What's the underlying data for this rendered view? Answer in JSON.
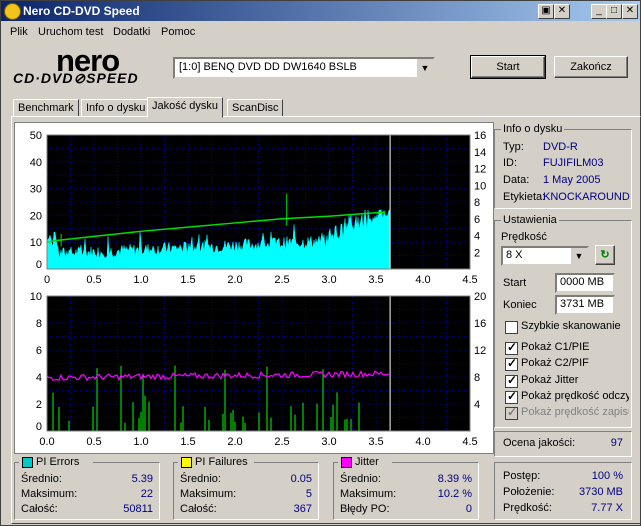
{
  "window": {
    "title": "Nero CD-DVD Speed"
  },
  "menu": [
    "Plik",
    "Uruchom test",
    "Dodatki",
    "Pomoc"
  ],
  "logo": {
    "brand": "nero",
    "product": "CD·DVD⊘SPEED"
  },
  "drive": {
    "selected": "[1:0]  BENQ DVD DD DW1640 BSLB"
  },
  "buttons": {
    "start": "Start",
    "stop": "Zakończ"
  },
  "tabs": [
    "Benchmark",
    "Info o dysku",
    "Jakość dysku",
    "ScanDisc"
  ],
  "active_tab": 2,
  "disc_info": {
    "title": "Info o dysku",
    "rows": [
      {
        "label": "Typ:",
        "value": "DVD-R"
      },
      {
        "label": "ID:",
        "value": "FUJIFILM03"
      },
      {
        "label": "Data:",
        "value": "1 May 2005"
      },
      {
        "label": "Etykieta:",
        "value": "KNOCKAROUND"
      }
    ]
  },
  "settings": {
    "title": "Ustawienia",
    "speed_label": "Prędkość",
    "speed_value": "8 X",
    "start_label": "Start",
    "start_value": "0000 MB",
    "end_label": "Koniec",
    "end_value": "3731 MB",
    "options": [
      {
        "label": "Szybkie skanowanie",
        "checked": false,
        "enabled": true
      },
      {
        "label": "Pokaż C1/PIE",
        "checked": true,
        "enabled": true
      },
      {
        "label": "Pokaż C2/PIF",
        "checked": true,
        "enabled": true
      },
      {
        "label": "Pokaż Jitter",
        "checked": true,
        "enabled": true
      },
      {
        "label": "Pokaż prędkość odczytu",
        "checked": true,
        "enabled": true
      },
      {
        "label": "Pokaż prędkość zapisu",
        "checked": true,
        "enabled": false
      }
    ]
  },
  "quality": {
    "label": "Ocena jakości:",
    "value": "97"
  },
  "pi_errors": {
    "title": "PI Errors",
    "color": "#00c8c8",
    "rows": [
      {
        "label": "Średnio:",
        "value": "5.39"
      },
      {
        "label": "Maksimum:",
        "value": "22"
      },
      {
        "label": "Całość:",
        "value": "50811"
      }
    ]
  },
  "pi_failures": {
    "title": "PI Failures",
    "color": "#ffff00",
    "rows": [
      {
        "label": "Średnio:",
        "value": "0.05"
      },
      {
        "label": "Maksimum:",
        "value": "5"
      },
      {
        "label": "Całość:",
        "value": "367"
      }
    ]
  },
  "jitter": {
    "title": "Jitter",
    "color": "#ff00ff",
    "rows": [
      {
        "label": "Średnio:",
        "value": "8.39 %"
      },
      {
        "label": "Maksimum:",
        "value": "10.2 %"
      },
      {
        "label": "Błędy PO:",
        "value": "0"
      }
    ]
  },
  "progress": {
    "rows": [
      {
        "label": "Postęp:",
        "value": "100 %"
      },
      {
        "label": "Położenie:",
        "value": "3730 MB"
      },
      {
        "label": "Prędkość:",
        "value": "7.77 X"
      }
    ]
  },
  "chart_data": [
    {
      "type": "area",
      "series": [
        {
          "name": "PI Errors",
          "color": "#00ffff",
          "values_note": "dense noise",
          "avg": 5.39,
          "max": 22
        },
        {
          "name": "Read speed",
          "color": "#00ff00",
          "x": [
            0,
            0.1,
            0.5,
            1.0,
            1.5,
            2.0,
            2.5,
            3.0,
            3.6
          ],
          "y": [
            3.2,
            3.4,
            3.9,
            4.5,
            5.0,
            5.5,
            6.0,
            6.3,
            6.8
          ]
        }
      ],
      "x_ticks": [
        "0",
        "0.5",
        "1.0",
        "1.5",
        "2.0",
        "2.5",
        "3.0",
        "3.5",
        "4.0",
        "4.5"
      ],
      "y_left_ticks": [
        "10",
        "20",
        "30",
        "40",
        "50"
      ],
      "y_right_ticks": [
        "2",
        "4",
        "6",
        "8",
        "10",
        "12",
        "14",
        "16"
      ],
      "xlim": [
        0,
        4.5
      ],
      "ylim_left": [
        0,
        50
      ],
      "ylim_right": [
        0,
        16
      ],
      "end_marker": 3.65
    },
    {
      "type": "bar",
      "series": [
        {
          "name": "PI Failures",
          "color": "#00ff00",
          "avg": 0.05,
          "max": 5
        },
        {
          "name": "Jitter",
          "color": "#ff00ff",
          "avg": 8.39,
          "max": 10.2
        }
      ],
      "x_ticks": [
        "0.0",
        "0.5",
        "1.0",
        "1.5",
        "2.0",
        "2.5",
        "3.0",
        "3.5",
        "4.0",
        "4.5"
      ],
      "y_left_ticks": [
        "2",
        "4",
        "6",
        "8",
        "10"
      ],
      "y_right_ticks": [
        "4",
        "8",
        "12",
        "16",
        "20"
      ],
      "xlim": [
        0,
        4.5
      ],
      "ylim_left": [
        0,
        10
      ],
      "ylim_right": [
        0,
        20
      ],
      "end_marker": 3.65
    }
  ]
}
